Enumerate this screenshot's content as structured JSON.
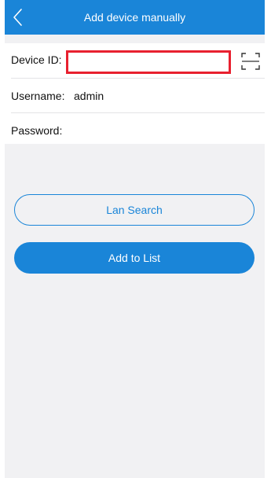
{
  "nav": {
    "title": "Add device manually",
    "back_icon": "chevron-left-icon"
  },
  "form": {
    "device_id": {
      "label": "Device ID:",
      "value": ""
    },
    "username": {
      "label": "Username:",
      "value": "admin"
    },
    "password": {
      "label": "Password:",
      "value": ""
    },
    "scan_icon": "scan-frame-icon"
  },
  "actions": {
    "lan_search_label": "Lan Search",
    "add_to_list_label": "Add to List"
  },
  "colors": {
    "accent": "#1a85d8",
    "highlight": "#e8202f",
    "background": "#f1f1f3"
  }
}
